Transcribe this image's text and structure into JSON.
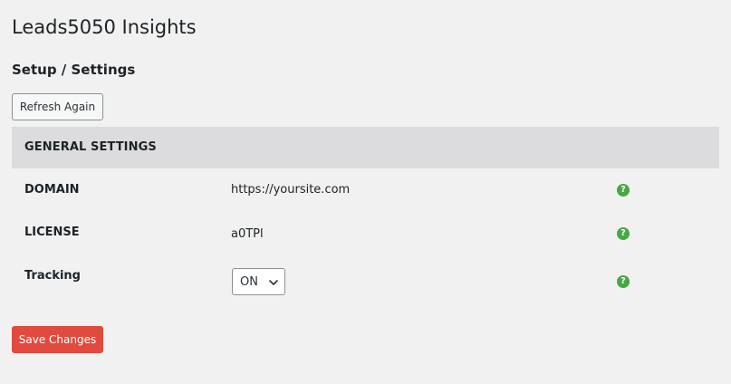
{
  "page": {
    "title": "Leads5050 Insights",
    "section_title": "Setup / Settings"
  },
  "toolbar": {
    "refresh_label": "Refresh Again"
  },
  "settings": {
    "header": "GENERAL SETTINGS",
    "rows": [
      {
        "label": "DOMAIN",
        "value": "https://yoursite.com",
        "help": "?"
      },
      {
        "label": "LICENSE",
        "value": "a0TPl",
        "help": "?"
      },
      {
        "label": "Tracking",
        "select_value": "ON",
        "help": "?"
      }
    ]
  },
  "footer": {
    "save_label": "Save Changes"
  },
  "colors": {
    "background": "#f1f1f1",
    "header_bg": "#dcdcde",
    "help_icon": "#46a843",
    "save_button": "#e04a3f"
  },
  "icons": {
    "help": "question-circle-icon",
    "dropdown": "chevron-down-icon"
  }
}
